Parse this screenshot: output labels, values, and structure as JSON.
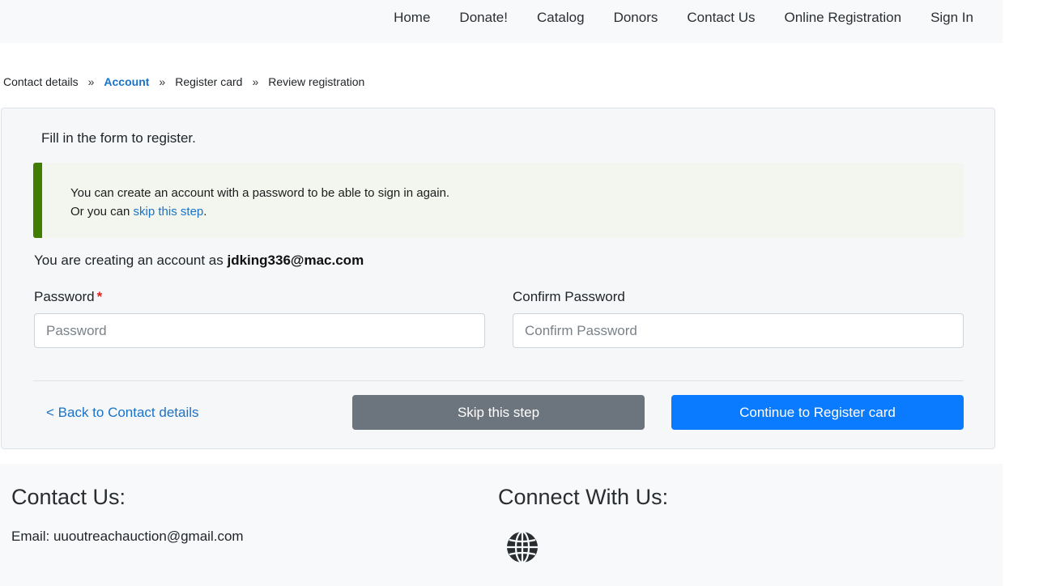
{
  "nav": {
    "items": [
      "Home",
      "Donate!",
      "Catalog",
      "Donors",
      "Contact Us",
      "Online Registration",
      "Sign In"
    ]
  },
  "breadcrumb": {
    "steps": [
      "Contact details",
      "Account",
      "Register card",
      "Review registration"
    ],
    "separator": "»",
    "active_index": 1
  },
  "form": {
    "intro": "Fill in the form to register.",
    "notice": {
      "line1": "You can create an account with a password to be able to sign in again.",
      "line2_prefix": "Or you can ",
      "line2_link": "skip this step",
      "line2_suffix": "."
    },
    "creating_prefix": "You are creating an account as ",
    "email": "jdking336@mac.com",
    "password": {
      "label": "Password",
      "required_mark": "*",
      "placeholder": "Password",
      "value": ""
    },
    "confirm_password": {
      "label": "Confirm Password",
      "placeholder": "Confirm Password",
      "value": ""
    },
    "back_link": "< Back to Contact details",
    "skip_button": "Skip this step",
    "continue_button": "Continue to Register card"
  },
  "footer": {
    "contact_heading": "Contact Us:",
    "email_text": "Email: uuoutreachauction@gmail.com",
    "connect_heading": "Connect With Us:",
    "connect_icon": "globe-icon"
  },
  "colors": {
    "accent": "#0a7bff",
    "link": "#1a73c8",
    "notice_border": "#3f7e00",
    "secondary_button": "#6c757d",
    "required": "#e0201b"
  }
}
